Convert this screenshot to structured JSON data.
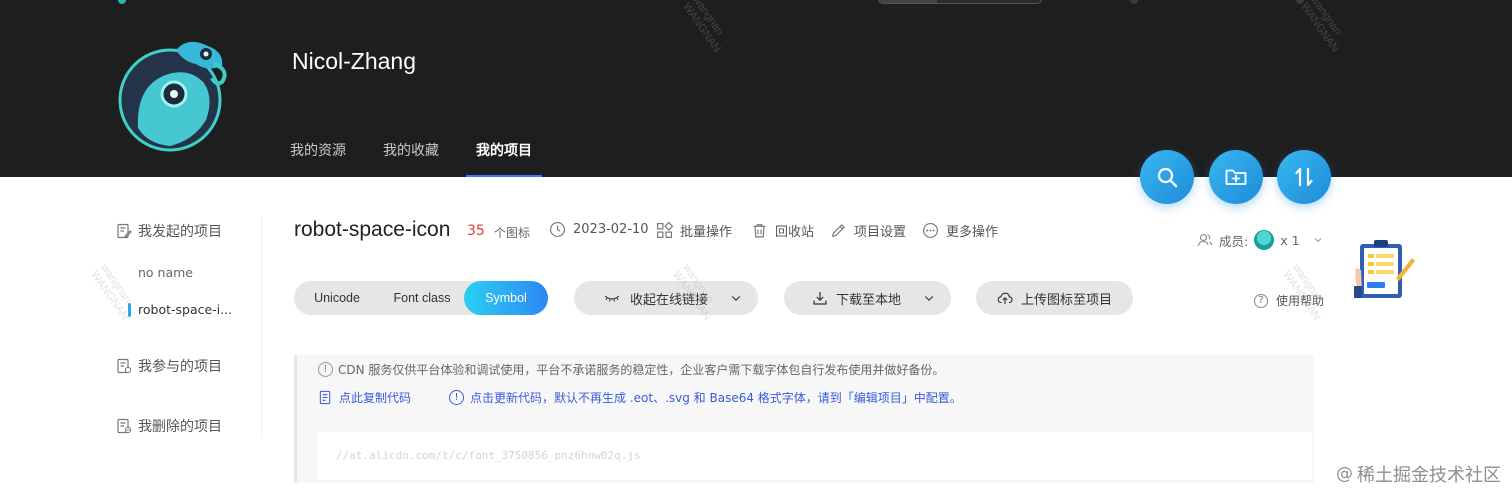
{
  "header": {
    "username": "Nicol-Zhang",
    "tabs": [
      {
        "label": "我的资源",
        "active": false
      },
      {
        "label": "我的收藏",
        "active": false
      },
      {
        "label": "我的项目",
        "active": true
      }
    ],
    "action_buttons": [
      {
        "name": "search",
        "icon": "search-icon"
      },
      {
        "name": "new-project",
        "icon": "folder-plus-icon"
      },
      {
        "name": "sort",
        "icon": "sort-icon"
      }
    ]
  },
  "sidebar": {
    "created_group": "我发起的项目",
    "created_projects": [
      "no name",
      "robot-space-i..."
    ],
    "active_project_index": 1,
    "joined_group": "我参与的项目",
    "deleted_group": "我删除的项目"
  },
  "project": {
    "name": "robot-space-icon",
    "icon_count": "35",
    "icon_count_label": "个图标",
    "date": "2023-02-10",
    "batch_ops": "批量操作",
    "recycle_bin": "回收站",
    "settings": "项目设置",
    "more_ops": "更多操作",
    "members_label": "成员:",
    "members_count": "x 1",
    "help": "使用帮助"
  },
  "toolbar": {
    "formats": [
      "Unicode",
      "Font class",
      "Symbol"
    ],
    "selected_format": "Symbol",
    "online_link": "收起在线链接",
    "download": "下载至本地",
    "upload": "上传图标至项目"
  },
  "notice": {
    "info": "CDN 服务仅供平台体验和调试使用，平台不承诺服务的稳定性，企业客户需下载字体包自行发布使用并做好备份。",
    "copy_code": "点此复制代码",
    "refresh_code": "点击更新代码，默认不再生成 .eot、.svg 和 Base64 格式字体，请到「编辑项目」中配置。",
    "code_url": "//at.alicdn.com/t/c/font_3750856_pnz6hnw02q.js"
  },
  "watermark": {
    "text": "wangnan\nWANGNAN",
    "footer": "稀土掘金技术社区"
  },
  "colors": {
    "header_bg": "#1e1e1f",
    "accent_blue": "#2d87f2",
    "accent_cyan": "#2ad0f1",
    "count_red": "#e0393e",
    "link_blue": "#3a5bd9"
  }
}
